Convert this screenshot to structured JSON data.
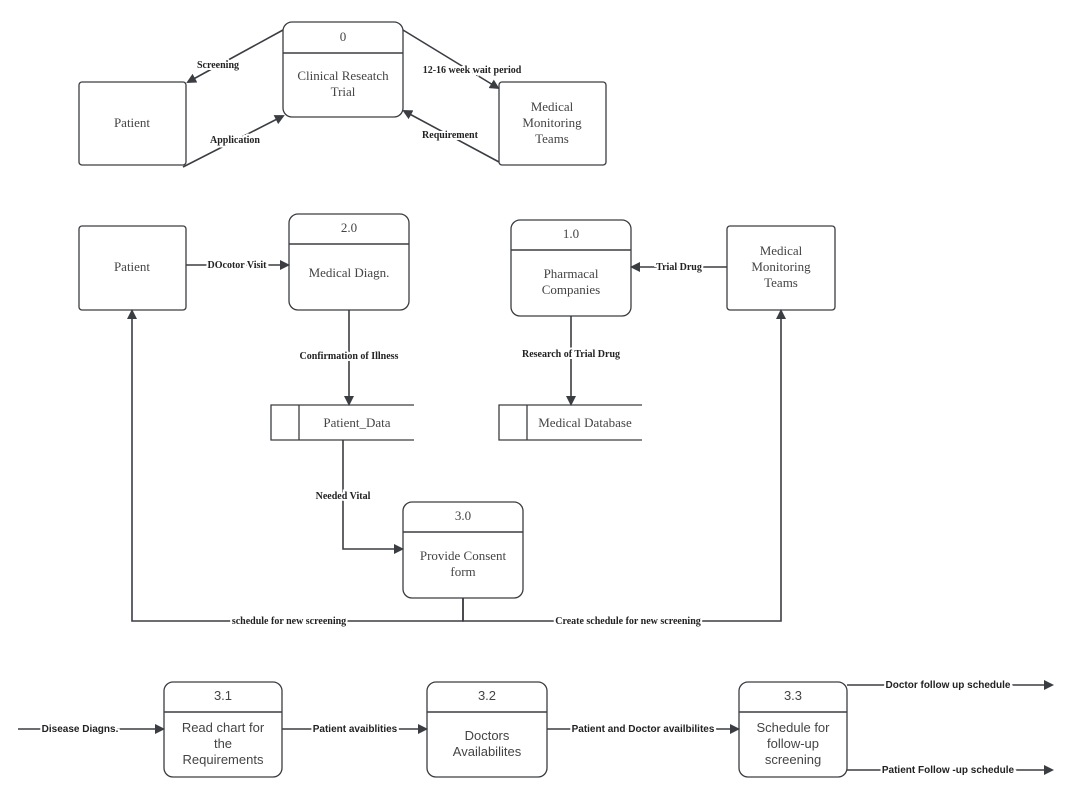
{
  "level0": {
    "patient": "Patient",
    "process": {
      "id": "0",
      "lines": [
        "Clinical Reseatch",
        "Trial"
      ]
    },
    "monitoring": [
      "Medical",
      "Monitoring",
      "Teams"
    ],
    "flows": {
      "screening": "Screening",
      "application": "Application",
      "wait": "12-16 week wait period",
      "requirement": "Requirement"
    }
  },
  "level1": {
    "patient": "Patient",
    "p2": {
      "id": "2.0",
      "lines": [
        "Medical Diagn."
      ]
    },
    "p1": {
      "id": "1.0",
      "lines": [
        "Pharmacal",
        "Companies"
      ]
    },
    "monitoring": [
      "Medical",
      "Monitoring",
      "Teams"
    ],
    "p3": {
      "id": "3.0",
      "lines": [
        "Provide Consent",
        "form"
      ]
    },
    "store_patient": "Patient_Data",
    "store_db": "Medical Database",
    "flows": {
      "visit": "DOcotor Visit",
      "trial_drug": "Trial Drug",
      "confirmation": "Confirmation of Illness",
      "research": "Research of Trial Drug",
      "vital": "Needed Vital",
      "schedule": "schedule for new screening",
      "create_schedule": "Create  schedule for new screening"
    }
  },
  "level2": {
    "p31": {
      "id": "3.1",
      "lines": [
        "Read chart for",
        "the",
        "Requirements"
      ]
    },
    "p32": {
      "id": "3.2",
      "lines": [
        "Doctors",
        "Availabilites"
      ]
    },
    "p33": {
      "id": "3.3",
      "lines": [
        "Schedule for",
        "follow-up",
        "screening"
      ]
    },
    "flows": {
      "disease": "Disease Diagns.",
      "patient_avail": "Patient avaiblities",
      "both_avail": "Patient and Doctor availbilites",
      "doctor_follow": "Doctor follow up schedule",
      "patient_follow": "Patient Follow -up schedule"
    }
  }
}
